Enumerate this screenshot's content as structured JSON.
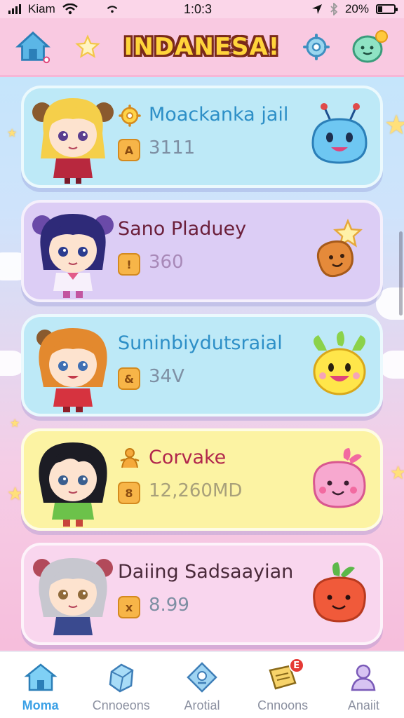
{
  "status_bar": {
    "carrier": "Kiam",
    "time": "1:0:3",
    "battery": "20%"
  },
  "header": {
    "title": "INDANESA!",
    "home_icon": "house-icon",
    "star_icon": "star-icon",
    "settings_icon": "gear-icon",
    "profile_icon": "smile-blob-icon"
  },
  "cards": [
    {
      "name": "Moackanka jail",
      "score": "3111",
      "color": "blue",
      "name_color": "#2d8fc7",
      "score_icon_glyph": "A",
      "has_name_icon": true
    },
    {
      "name": "Sano Pladuey",
      "score": "360",
      "color": "purple",
      "name_color": "#6b1f3a",
      "score_icon_glyph": "!",
      "has_name_icon": false
    },
    {
      "name": "Suninbiydutsraial",
      "score": "34V",
      "color": "blue",
      "name_color": "#2d8fc7",
      "score_icon_glyph": "&",
      "has_name_icon": false
    },
    {
      "name": "Corvake",
      "score": "12,260MD",
      "color": "yellow",
      "name_color": "#b1264c",
      "score_icon_glyph": "8",
      "has_name_icon": true
    },
    {
      "name": "Daiing Sadsaayian",
      "score": "8.99",
      "color": "pink",
      "name_color": "#4a2a3a",
      "score_icon_glyph": "x",
      "has_name_icon": false
    }
  ],
  "nav": [
    {
      "label": "Moma",
      "icon": "home-icon",
      "active": true
    },
    {
      "label": "Cnnoeons",
      "icon": "gem-box-icon",
      "active": false
    },
    {
      "label": "Arotial",
      "icon": "gem-icon",
      "active": false
    },
    {
      "label": "Cnnoons",
      "icon": "book-icon",
      "active": false,
      "badge": "E"
    },
    {
      "label": "Anaiit",
      "icon": "user-icon",
      "active": false
    }
  ]
}
